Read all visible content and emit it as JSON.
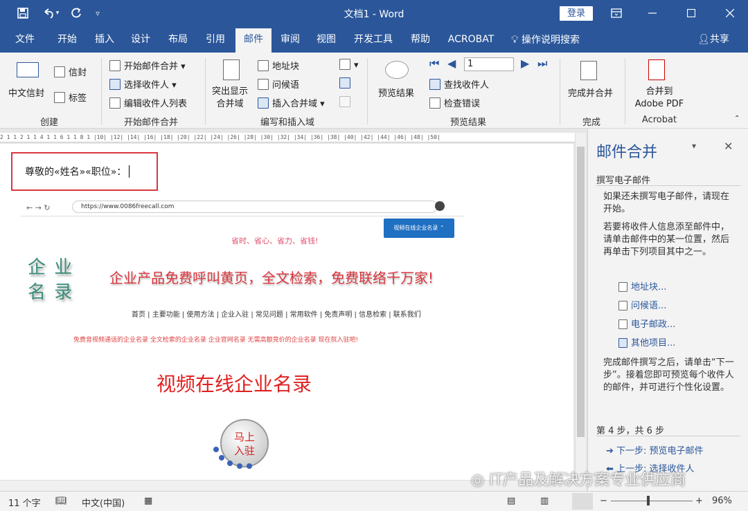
{
  "window": {
    "title": "文档1 - Word",
    "login": "登录"
  },
  "quick_access": {
    "save": "save-icon",
    "undo": "undo-icon",
    "redo": "redo-icon",
    "customize": "customize-icon"
  },
  "tabs": [
    "文件",
    "开始",
    "插入",
    "设计",
    "布局",
    "引用",
    "邮件",
    "审阅",
    "视图",
    "开发工具",
    "帮助",
    "ACROBAT"
  ],
  "tell_me": "操作说明搜索",
  "share": "共享",
  "ribbon": {
    "create": {
      "label": "创建",
      "chinese_envelope": "中文信封",
      "envelope": "信封",
      "labels": "标签"
    },
    "start": {
      "label": "开始邮件合并",
      "start_merge": "开始邮件合并",
      "select_recipients": "选择收件人",
      "edit_list": "编辑收件人列表"
    },
    "write": {
      "label": "编写和插入域",
      "highlight_line1": "突出显示",
      "highlight_line2": "合并域",
      "address_block": "地址块",
      "greeting": "问候语",
      "insert_field": "插入合并域"
    },
    "preview": {
      "label": "预览结果",
      "preview_results": "预览结果",
      "record": "1",
      "find_recipient": "查找收件人",
      "check_errors": "检查错误"
    },
    "finish": {
      "label": "完成",
      "finish_merge": "完成并合并"
    },
    "acrobat": {
      "label": "Acrobat",
      "merge_line1": "合并到",
      "merge_line2": "Adobe PDF"
    }
  },
  "document": {
    "salutation": "尊敬的«姓名»«职位»：",
    "browser_url": "https://www.0086freecall.com",
    "video_button": "视频在线企业名录",
    "slogan_small": "省时、省心、省力、省钱!",
    "logo_line1": "企 业",
    "logo_line2": "名 录",
    "headline": "企业产品免费呼叫黄页，全文检索，免费联络千万家!",
    "nav": "首页 | 主要功能 | 使用方法 | 企业入驻 | 常见问题 | 常用软件 | 免责声明 | 信息检索 | 联系我们",
    "features": "免费音视频通话的企业名录  全文检索的企业名录  企业官网名录  无需高额竞价的企业名录  现在就入驻吧!",
    "big_title": "视频在线企业名录",
    "join_line1": "马上",
    "join_line2": "入驻"
  },
  "ruler_text": "2 1  1 2 1  1 4 1  1 6 1  1 8 1  |10|  |12|  |14|  |16|  |18|  |20|  |22|  |24|  |26|  |28|  |30|  |32|  |34|  |36|  |38|  |40|  |42|  |44|  |46|  |48|  |50|",
  "pane": {
    "title": "邮件合并",
    "section": "撰写电子邮件",
    "p1": "如果还未撰写电子邮件，请现在开始。",
    "p2": "若要将收件人信息添至邮件中，请单击邮件中的某一位置，然后再单击下列项目其中之一。",
    "links": [
      "地址块...",
      "问候语...",
      "电子邮政...",
      "其他项目..."
    ],
    "p3": "完成邮件撰写之后，请单击“下一步”。接着您即可预览每个收件人的邮件，并可进行个性化设置。",
    "step": "第 4 步，共 6 步",
    "next": "下一步: 预览电子邮件",
    "prev": "上一步: 选择收件人"
  },
  "status": {
    "words": "11 个字",
    "language": "中文(中国)",
    "zoom": "96%"
  },
  "watermark": "IT产品及解决方案专业供应商"
}
